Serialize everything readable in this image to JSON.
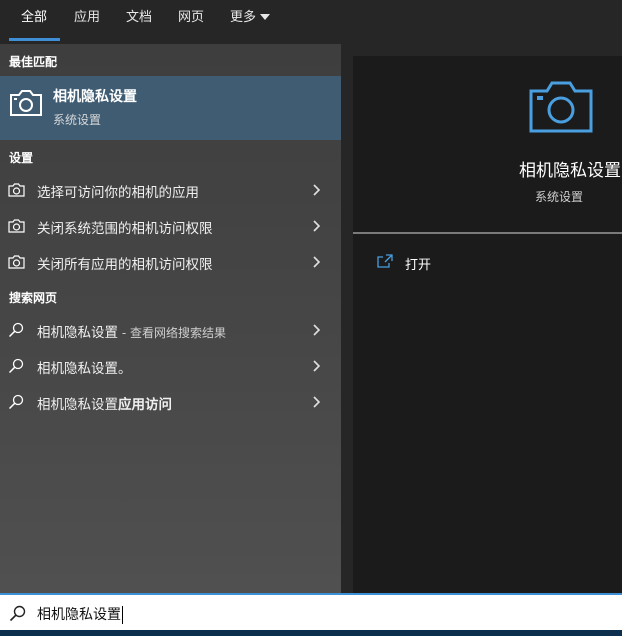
{
  "tabs": {
    "all": "全部",
    "apps": "应用",
    "docs": "文档",
    "web": "网页",
    "more": "更多"
  },
  "sections": {
    "best_match": "最佳匹配",
    "settings": "设置",
    "search_web": "搜索网页"
  },
  "best_match": {
    "title": "相机隐私设置",
    "subtitle": "系统设置",
    "icon": "camera-icon"
  },
  "settings_items": [
    {
      "label": "选择可访问你的相机的应用",
      "icon": "camera-icon"
    },
    {
      "label": "关闭系统范围的相机访问权限",
      "icon": "camera-icon"
    },
    {
      "label": "关闭所有应用的相机访问权限",
      "icon": "camera-icon"
    }
  ],
  "web_items": [
    {
      "label": "相机隐私设置",
      "suffix": " - 查看网络搜索结果",
      "icon": "search-icon"
    },
    {
      "label": "相机隐私设置。",
      "icon": "search-icon"
    },
    {
      "label": "相机隐私设置",
      "bold_suffix": "应用访问",
      "icon": "search-icon"
    }
  ],
  "preview": {
    "title": "相机隐私设置",
    "subtitle": "系统设置",
    "open_label": "打开"
  },
  "search": {
    "value": "相机隐私设置"
  },
  "colors": {
    "accent": "#3e8fd6",
    "best_match_bg": "#3f5c73",
    "icon_blue": "#4a9fe0"
  }
}
